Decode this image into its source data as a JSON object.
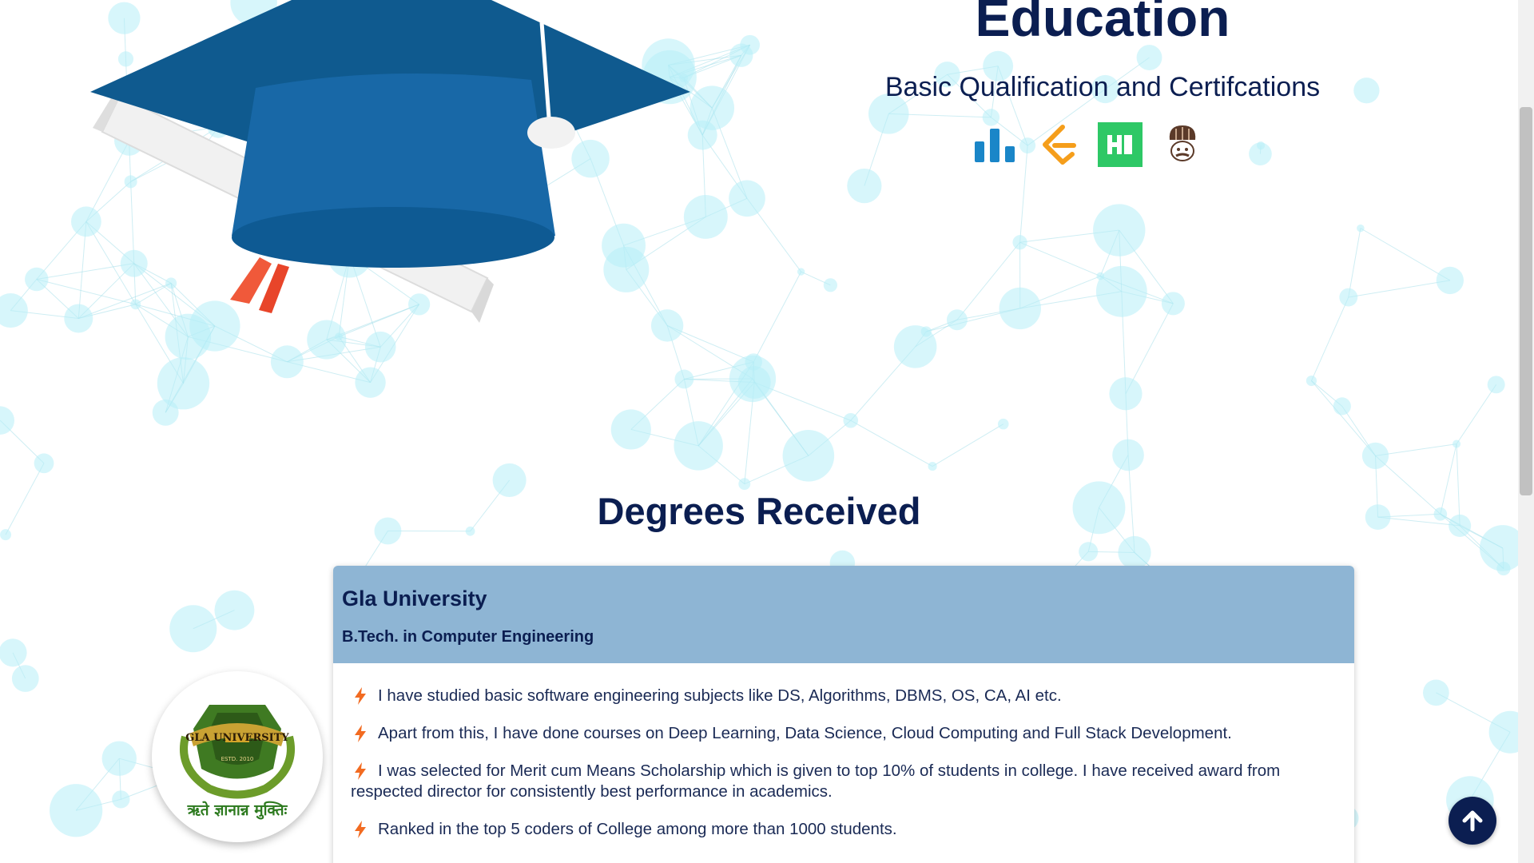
{
  "education": {
    "title": "Education",
    "subtitle": "Basic Qualification and Certifcations"
  },
  "certifications": [
    {
      "name": "codechef-bars-icon",
      "color": "#1a86c8"
    },
    {
      "name": "leetcode-icon",
      "color": "#f59e1b"
    },
    {
      "name": "hackerearth-icon",
      "color": "#2ec866"
    },
    {
      "name": "codechef-chef-icon",
      "color": "#5b3a29"
    }
  ],
  "degrees": {
    "title": "Degrees Received",
    "items": [
      {
        "university": "Gla University",
        "degree": "B.Tech. in Computer Engineering",
        "logo_text": "GLA UNIVERSITY",
        "logo_estd": "ESTD. 2010",
        "logo_motto": "ऋते ज्ञानान्न मुक्तिः",
        "points": [
          "I have studied basic software engineering subjects like DS, Algorithms, DBMS, OS, CA, AI etc.",
          "Apart from this, I have done courses on Deep Learning, Data Science, Cloud Computing and Full Stack Development.",
          "I was selected for Merit cum Means Scholarship which is given to top 10% of students in college. I have received award from respected director for consistently best performance in academics.",
          "Ranked in the top 5 coders of College among more than 1000 students."
        ]
      }
    ]
  },
  "colors": {
    "heading": "#0b1e51",
    "card_header": "#7eabce",
    "bolt": "#f26b21",
    "particle": "#b7eef7"
  },
  "scroll_top": {
    "icon": "arrow-up-icon"
  }
}
